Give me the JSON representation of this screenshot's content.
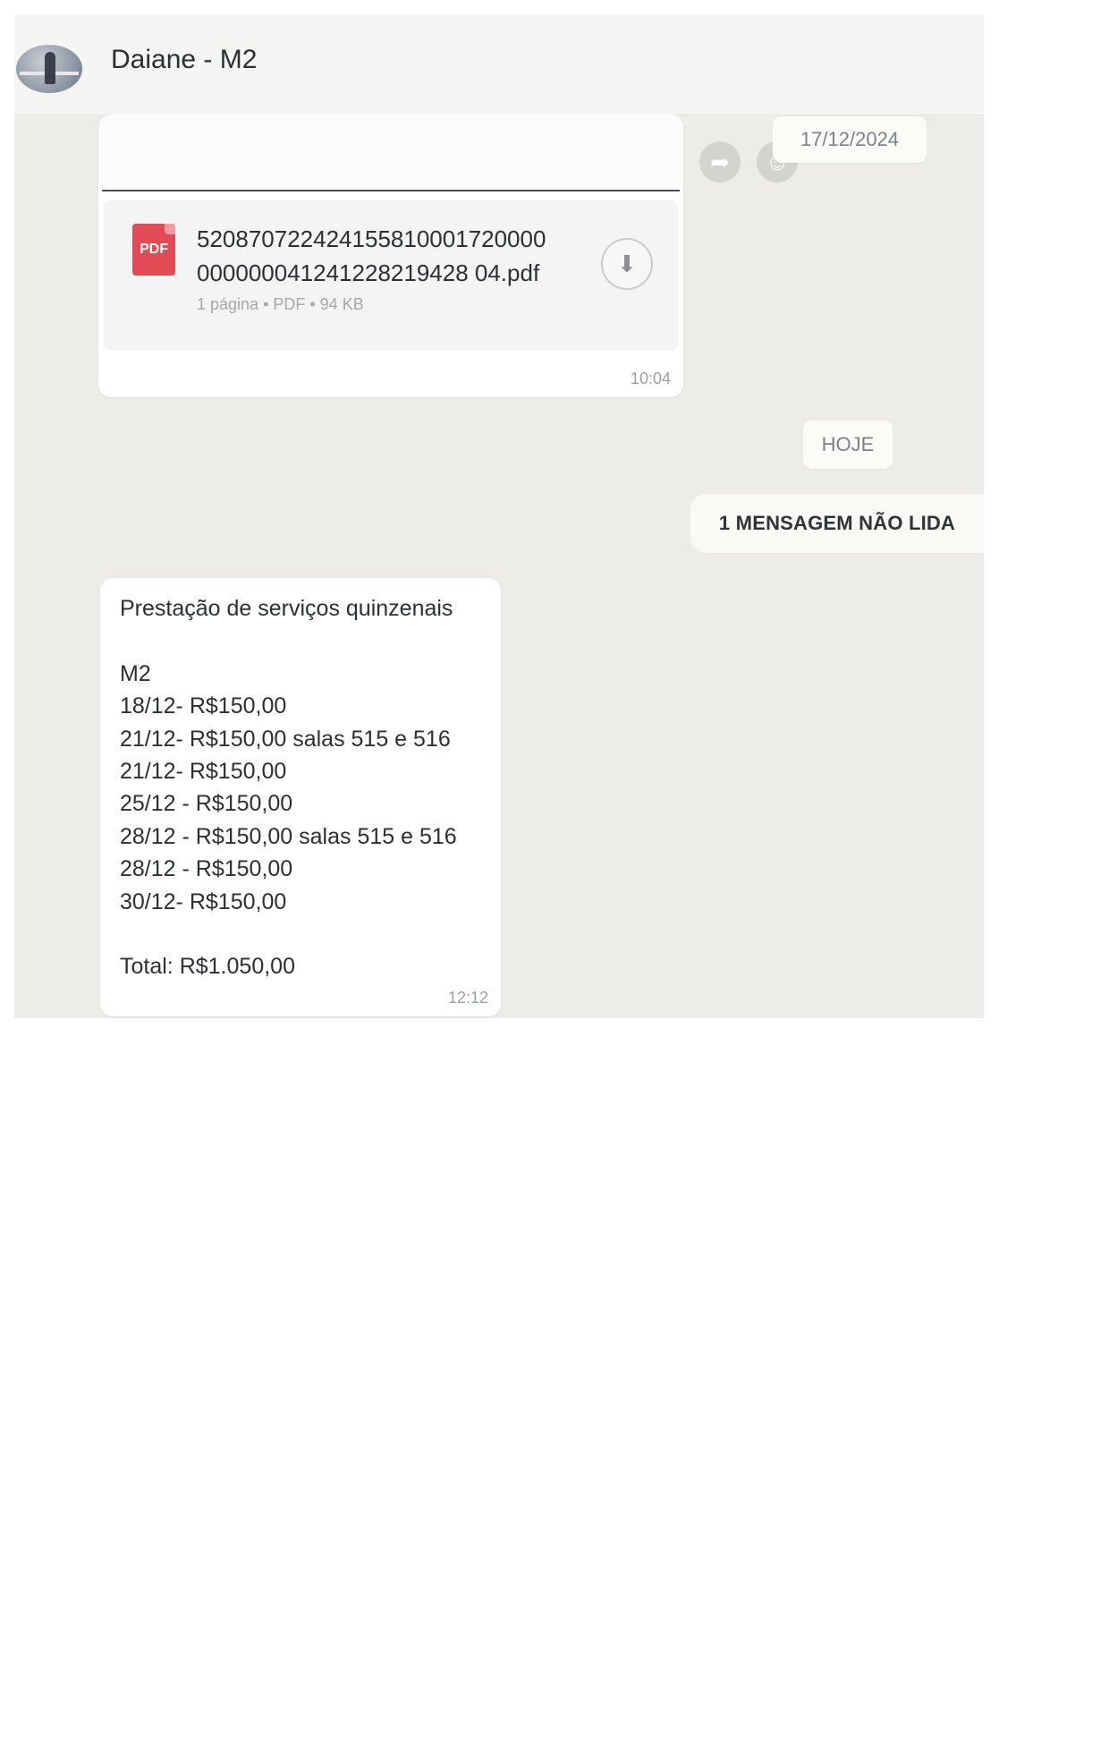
{
  "header": {
    "contact_name": "Daiane - M2"
  },
  "document_message": {
    "file_icon_label": "PDF",
    "filename": "520870722424155810001720000000000041241228219428 04.pdf",
    "meta": "1 página • PDF • 94 KB",
    "time": "10:04",
    "download_icon": "download-icon"
  },
  "actions": {
    "forward_icon": "forward-icon",
    "reaction_icon": "emoji-icon"
  },
  "date_chips": {
    "previous": "17/12/2024",
    "today": "HOJE"
  },
  "unread_banner": "1 MENSAGEM NÃO LIDA",
  "text_message": {
    "lines": [
      "Prestação de serviços quinzenais",
      "",
      "M2",
      "18/12- R$150,00",
      "21/12- R$150,00 salas 515 e 516",
      "21/12- R$150,00",
      "25/12 - R$150,00",
      "28/12 - R$150,00 salas 515 e 516",
      "28/12 - R$150,00",
      "30/12- R$150,00",
      "",
      "Total: R$1.050,00"
    ],
    "time": "12:12"
  }
}
